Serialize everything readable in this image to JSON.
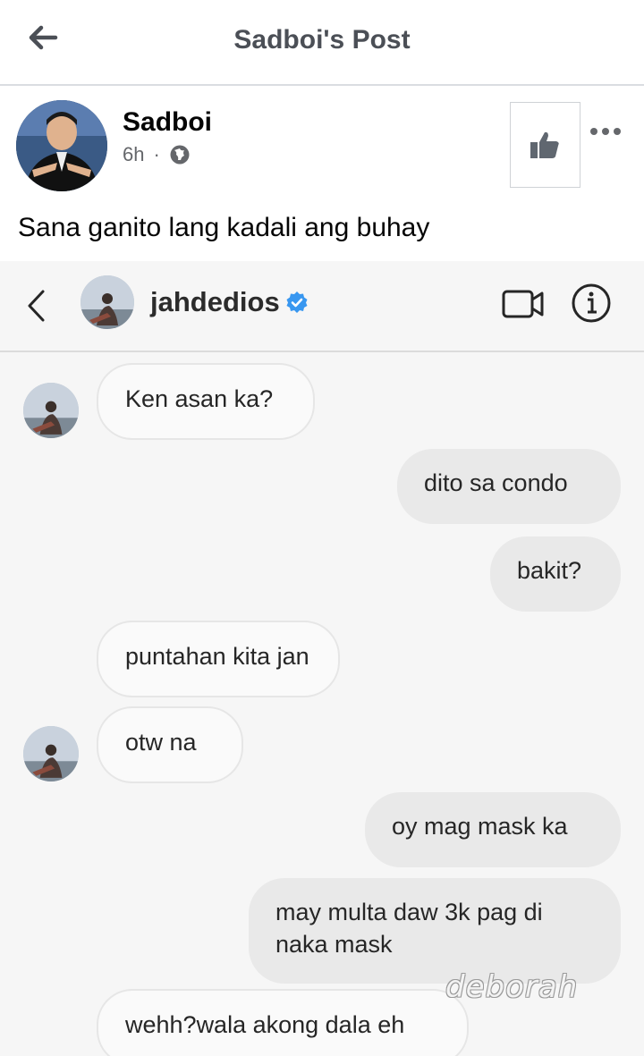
{
  "header": {
    "title": "Sadboi's Post"
  },
  "post": {
    "author": "Sadboi",
    "time": "6h",
    "separator": "·",
    "text": "Sana ganito lang kadali ang buhay"
  },
  "screenshot": {
    "username": "jahdedios",
    "messages": [
      {
        "text": "Ken asan ka?",
        "side": "incoming"
      },
      {
        "text": "dito sa condo",
        "side": "outgoing"
      },
      {
        "text": "bakit?",
        "side": "outgoing"
      },
      {
        "text": "puntahan kita jan",
        "side": "incoming"
      },
      {
        "text": "otw na",
        "side": "incoming"
      },
      {
        "text": "oy mag mask ka",
        "side": "outgoing"
      },
      {
        "text": "may multa daw 3k pag di naka mask",
        "side": "outgoing"
      },
      {
        "text": "wehh?wala akong dala eh",
        "side": "incoming"
      }
    ],
    "watermark": "deborah"
  },
  "colors": {
    "verified": "#3897f0",
    "meta_text": "#65676b"
  }
}
